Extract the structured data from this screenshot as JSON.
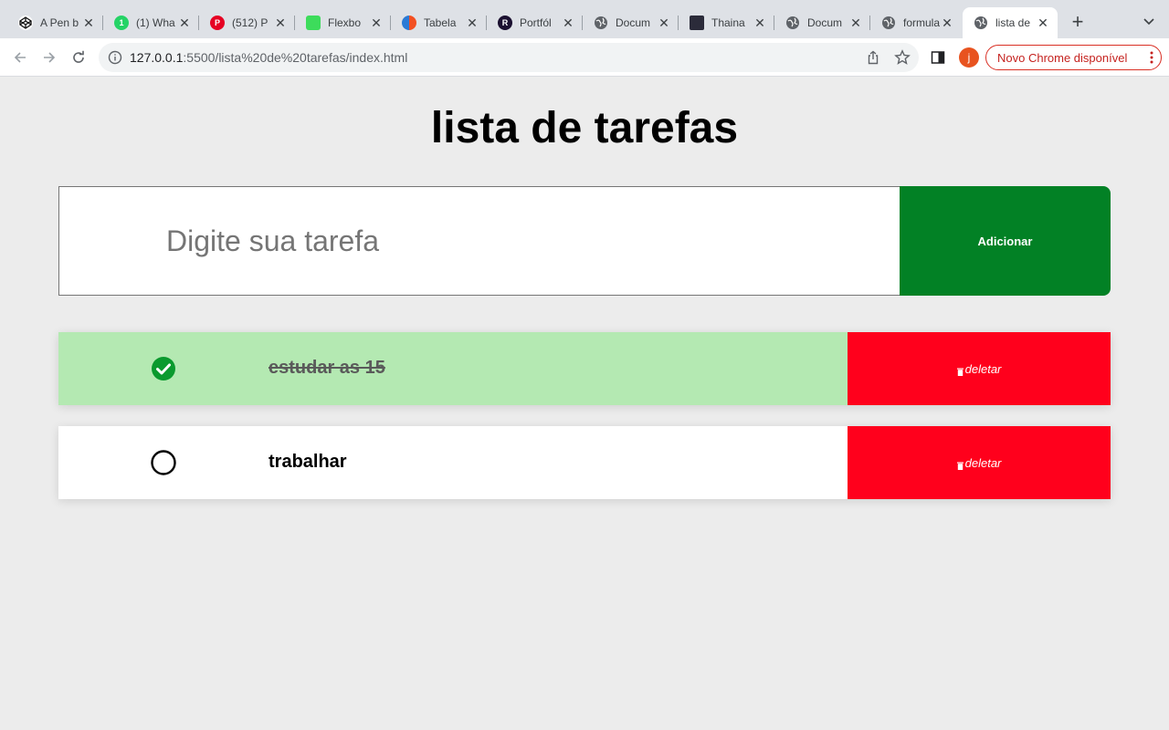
{
  "browser": {
    "tabs": [
      {
        "title": "A Pen b",
        "icon": "codepen-icon",
        "color": "#1e1f26"
      },
      {
        "title": "(1) Wha",
        "icon": "whatsapp-icon",
        "color": "#25d366"
      },
      {
        "title": "(512) P",
        "icon": "pinterest-icon",
        "color": "#e60023"
      },
      {
        "title": "Flexbo",
        "icon": "flexbox-froggy-icon",
        "color": "#3ddc5b"
      },
      {
        "title": "Tabela",
        "icon": "tabela-icon",
        "color": "#f25022"
      },
      {
        "title": "Portfól",
        "icon": "portfolio-icon",
        "color": "#1b1030"
      },
      {
        "title": "Docum",
        "icon": "globe-icon",
        "color": "#5f6368"
      },
      {
        "title": "Thaina",
        "icon": "profile-photo-icon",
        "color": "#2b2b3a"
      },
      {
        "title": "Docum",
        "icon": "globe-icon",
        "color": "#5f6368"
      },
      {
        "title": "formula",
        "icon": "globe-icon",
        "color": "#5f6368"
      },
      {
        "title": "lista de",
        "icon": "globe-icon",
        "color": "#5f6368",
        "active": true
      }
    ],
    "url_host": "127.0.0.1",
    "url_path": ":5500/lista%20de%20tarefas/index.html",
    "profile_initial": "j",
    "update_label": "Novo Chrome disponível"
  },
  "page": {
    "title": "lista de tarefas",
    "input_placeholder": "Digite sua tarefa",
    "input_value": "",
    "add_label": "Adicionar",
    "tasks": [
      {
        "text": "estudar as 15",
        "done": true,
        "delete_label": "deletar"
      },
      {
        "text": "trabalhar",
        "done": false,
        "delete_label": "deletar"
      }
    ]
  },
  "colors": {
    "add_button": "#028125",
    "delete_button": "#ff001c",
    "done_row": "#b4e9b2",
    "check_done": "#0a9a2e"
  }
}
